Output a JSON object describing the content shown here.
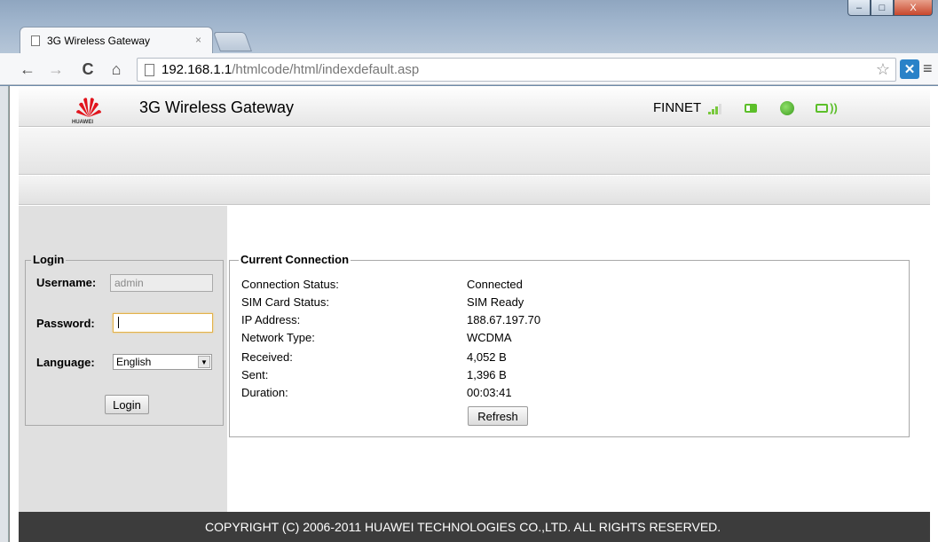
{
  "browser": {
    "tab_title": "3G Wireless Gateway",
    "tab_close": "×",
    "url_host": "192.168.1.1",
    "url_path": "/htmlcode/html/indexdefault.asp",
    "window_buttons": {
      "minimize": "–",
      "maximize": "□",
      "close": "X"
    }
  },
  "header": {
    "logo_text": "HUAWEI",
    "title": "3G Wireless Gateway",
    "carrier": "FINNET",
    "signal_bars": 3
  },
  "login": {
    "legend": "Login",
    "username_label": "Username:",
    "username_value": "admin",
    "password_label": "Password:",
    "password_value": "",
    "language_label": "Language:",
    "language_value": "English",
    "login_button": "Login"
  },
  "connection": {
    "legend": "Current Connection",
    "rows": [
      {
        "label": "Connection Status:",
        "value": "Connected"
      },
      {
        "label": "SIM Card Status:",
        "value": "SIM Ready"
      },
      {
        "label": "IP Address:",
        "value": "188.67.197.70"
      },
      {
        "label": "Network Type:",
        "value": "WCDMA"
      },
      {
        "label": "Received:",
        "value": "4,052 B"
      },
      {
        "label": "Sent:",
        "value": "1,396 B"
      },
      {
        "label": "Duration:",
        "value": "00:03:41"
      }
    ],
    "refresh_button": "Refresh"
  },
  "footer": {
    "copyright": "COPYRIGHT (C) 2006-2011 HUAWEI TECHNOLOGIES CO.,LTD. ALL RIGHTS RESERVED."
  },
  "colors": {
    "footer_bg": "#3c3c3c",
    "signal_green": "#78c83c",
    "status_green": "#5cbf2a",
    "sidebar_bg": "#e0e0e0"
  }
}
